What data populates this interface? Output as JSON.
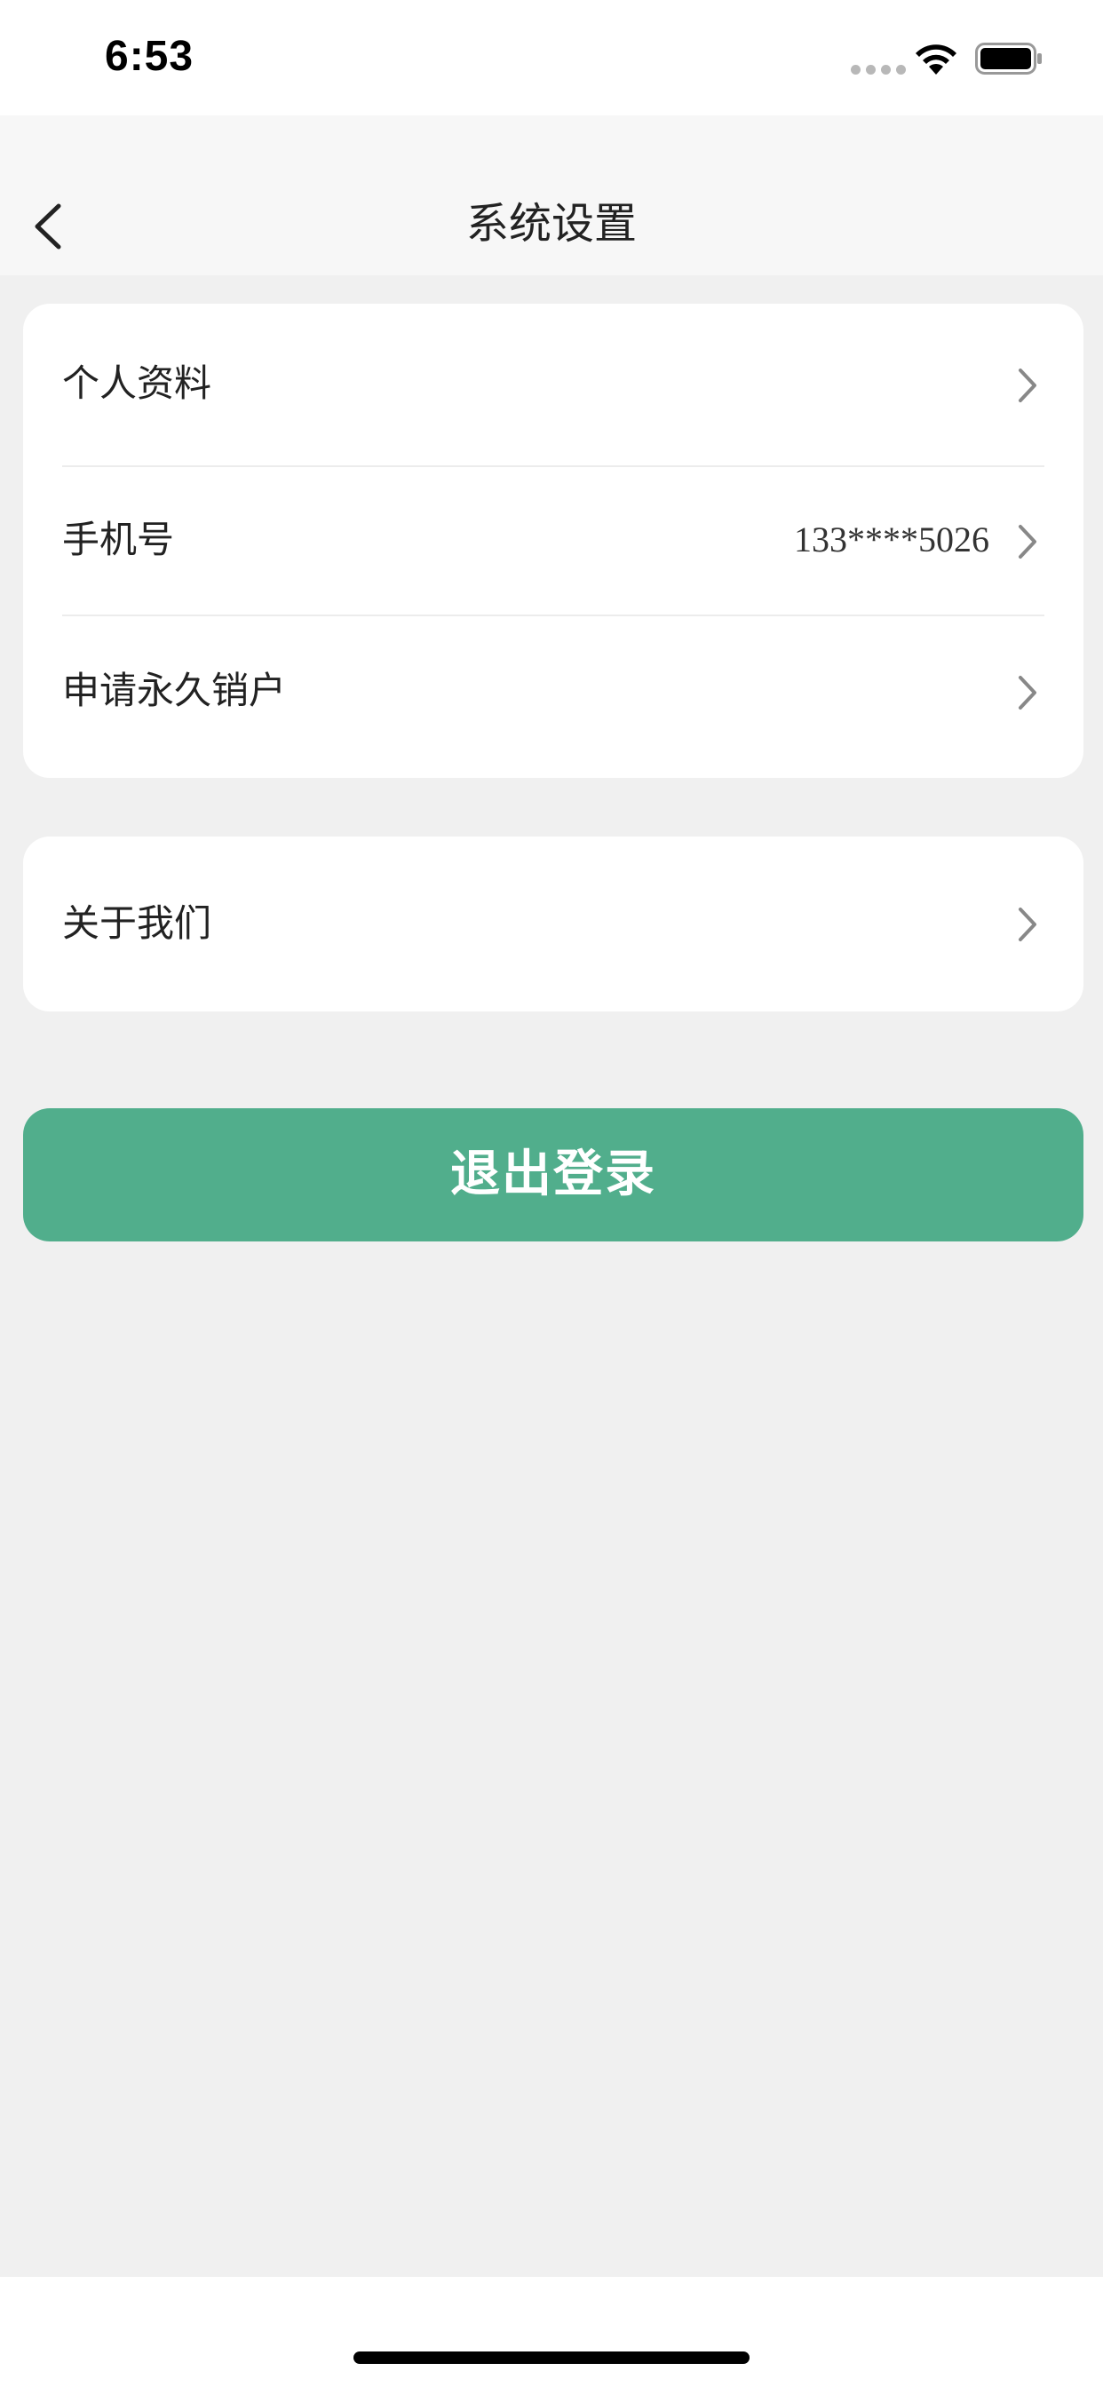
{
  "status_bar": {
    "time": "6:53"
  },
  "nav": {
    "title": "系统设置"
  },
  "settings_group_1": [
    {
      "label": "个人资料",
      "value": ""
    },
    {
      "label": "手机号",
      "value": "133****5026"
    },
    {
      "label": "申请永久销户",
      "value": ""
    }
  ],
  "settings_group_2": [
    {
      "label": "关于我们",
      "value": ""
    }
  ],
  "actions": {
    "logout_label": "退出登录"
  },
  "colors": {
    "accent": "#51ae8c",
    "background": "#f0f0f0",
    "card": "#ffffff"
  },
  "icons": [
    "back-icon",
    "chevron-right-icon",
    "wifi-icon",
    "battery-icon"
  ]
}
